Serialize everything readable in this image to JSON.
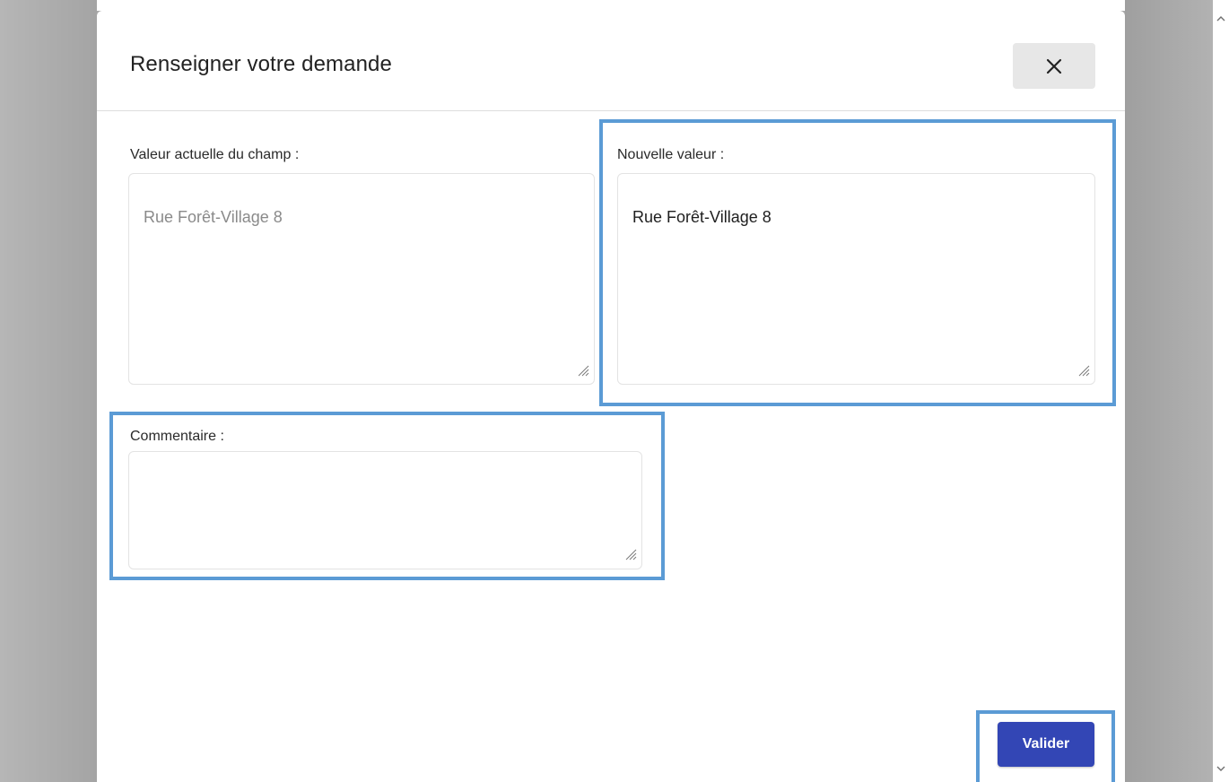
{
  "dialog": {
    "title": "Renseigner votre demande",
    "close_icon": "close-icon"
  },
  "fields": {
    "current_value": {
      "label": "Valeur actuelle du champ :",
      "value": "Rue Forêt-Village 8",
      "readonly": true
    },
    "new_value": {
      "label": "Nouvelle valeur :",
      "value": "Rue Forêt-Village 8"
    },
    "comment": {
      "label": "Commentaire :",
      "value": ""
    }
  },
  "actions": {
    "submit_label": "Valider"
  },
  "colors": {
    "highlight": "#5b9bd5",
    "primary_button": "#3346b5",
    "overlay": "#ababab",
    "close_button_bg": "#e7e7e7"
  },
  "icons": {
    "resize": "resize-handle-icon",
    "scroll_up": "scroll-up-arrow-icon",
    "scroll_down": "scroll-down-arrow-icon"
  }
}
